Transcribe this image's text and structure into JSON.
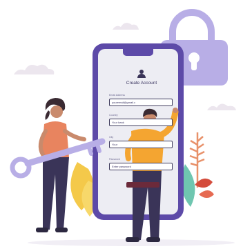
{
  "form": {
    "title": "Create Account",
    "fields": [
      {
        "label": "Email Address",
        "value": "youremail@gmail.c"
      },
      {
        "label": "Country",
        "value": "Your bank"
      },
      {
        "label": "City",
        "value": "Your"
      },
      {
        "label": "Password",
        "value": "Enter password"
      }
    ]
  },
  "colors": {
    "lock": "#b8aee6",
    "phone_frame": "#5d4aa8",
    "screen": "#ededf3",
    "cloud": "#ece6ee",
    "leaf_yellow": "#f4c94a",
    "leaf_teal": "#6fc6b0",
    "woman_shirt": "#e8845f",
    "man_shirt": "#f4a531",
    "pants": "#3a3458",
    "submit": "#6b2a3a"
  }
}
